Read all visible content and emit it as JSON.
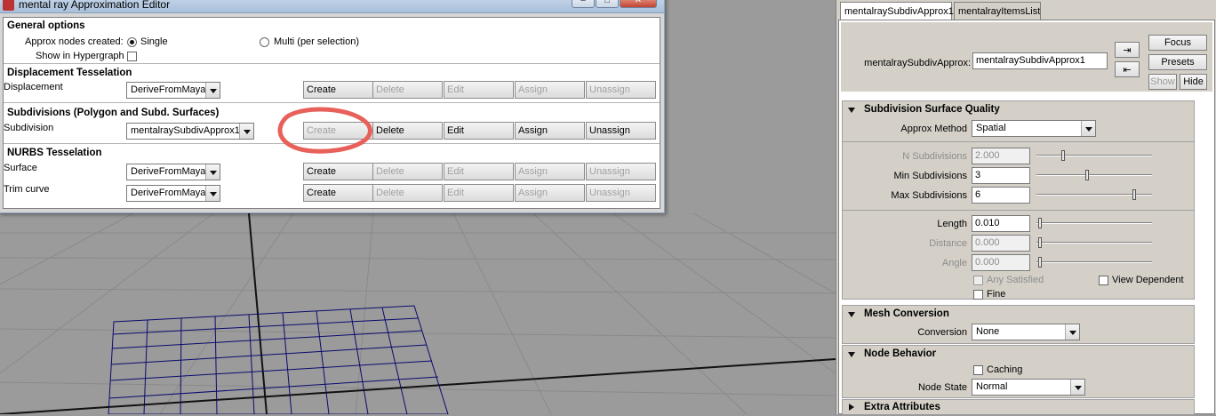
{
  "window": {
    "title": "mental ray Approximation Editor",
    "controls": [
      "–",
      "□",
      "✕"
    ]
  },
  "general": {
    "title": "General options",
    "approx_label": "Approx nodes created:",
    "single_label": "Single",
    "multi_label": "Multi (per selection)",
    "hypergraph_label": "Show in Hypergraph"
  },
  "displacement": {
    "title": "Displacement Tesselation",
    "row_label": "Displacement",
    "value": "DeriveFromMaya",
    "buttons": [
      "Create",
      "Delete",
      "Edit",
      "Assign",
      "Unassign"
    ]
  },
  "subdivisions": {
    "title": "Subdivisions (Polygon and Subd. Surfaces)",
    "row_label": "Subdivision",
    "value": "mentalraySubdivApprox1",
    "buttons": [
      "Create",
      "Delete",
      "Edit",
      "Assign",
      "Unassign"
    ]
  },
  "nurbs": {
    "title": "NURBS Tesselation",
    "surface_label": "Surface",
    "surface_value": "DeriveFromMaya",
    "trim_label": "Trim curve",
    "trim_value": "DeriveFromMaya",
    "buttons": [
      "Create",
      "Delete",
      "Edit",
      "Assign",
      "Unassign"
    ]
  },
  "panel": {
    "tabs": [
      "mentalraySubdivApprox1",
      "mentalrayItemsList"
    ],
    "node_label": "mentalraySubdivApprox:",
    "node_value": "mentalraySubdivApprox1",
    "focus": "Focus",
    "presets": "Presets",
    "show": "Show",
    "hide": "Hide",
    "quality": {
      "title": "Subdivision Surface Quality",
      "approx_method_label": "Approx Method",
      "approx_method_value": "Spatial",
      "n_sub_label": "N Subdivisions",
      "n_sub_value": "2.000",
      "min_sub_label": "Min Subdivisions",
      "min_sub_value": "3",
      "max_sub_label": "Max Subdivisions",
      "max_sub_value": "6",
      "length_label": "Length",
      "length_value": "0.010",
      "distance_label": "Distance",
      "distance_value": "0.000",
      "angle_label": "Angle",
      "angle_value": "0.000",
      "any_satisfied": "Any Satisfied",
      "view_dependent": "View Dependent",
      "fine": "Fine"
    },
    "mesh": {
      "title": "Mesh Conversion",
      "conversion_label": "Conversion",
      "conversion_value": "None"
    },
    "node_behavior": {
      "title": "Node Behavior",
      "caching": "Caching",
      "node_state_label": "Node State",
      "node_state_value": "Normal"
    },
    "extra": {
      "title": "Extra Attributes"
    }
  },
  "colors": {
    "annotation": "#e8605a",
    "grid": "#0a0a6e"
  }
}
